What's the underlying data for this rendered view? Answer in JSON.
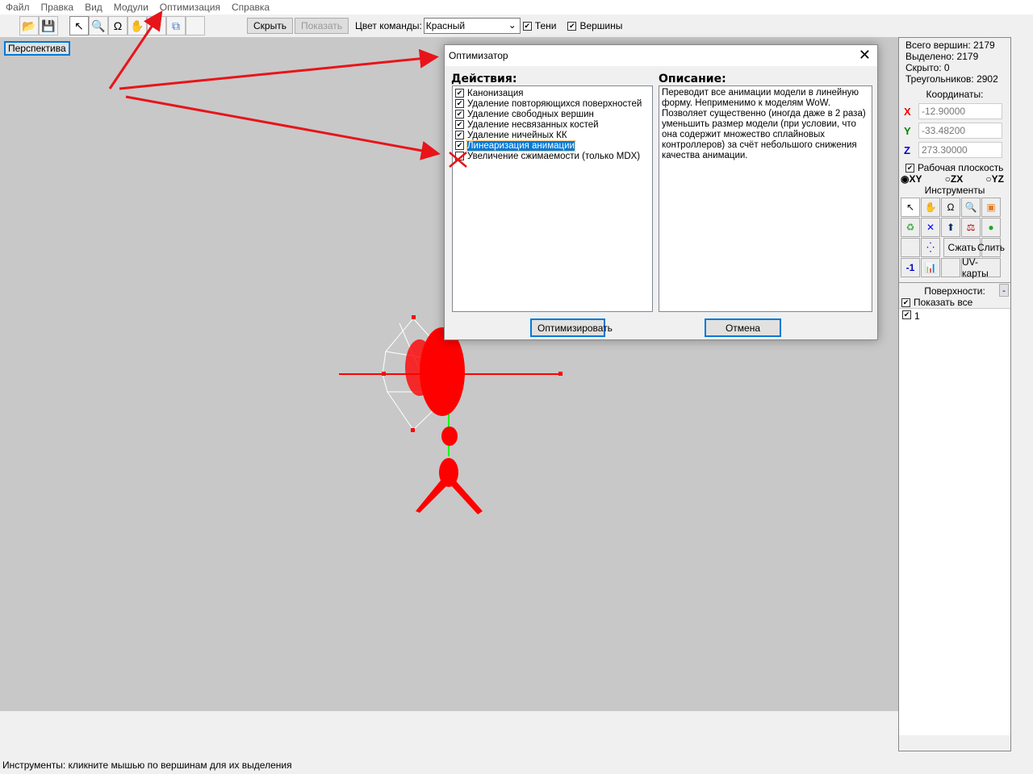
{
  "menu": [
    "Файл",
    "Правка",
    "Вид",
    "Модули",
    "Оптимизация",
    "Справка"
  ],
  "toolbar": {
    "hide": "Скрыть",
    "show": "Показать",
    "team_color_label": "Цвет команды:",
    "team_color": "Красный",
    "shadows": "Тени",
    "vertices": "Вершины"
  },
  "viewport": {
    "mode": "Перспектива"
  },
  "panel": {
    "total": "Всего вершин: 2179",
    "selected": "Выделено: 2179",
    "hidden": "Скрыто: 0",
    "triangles": "Треугольников: 2902",
    "coords_label": "Координаты:",
    "x": "-12.90000",
    "y": "-33.48200",
    "z": "273.30000",
    "work_plane": "Рабочая плоскость",
    "planes": [
      "XY",
      "ZX",
      "YZ"
    ],
    "tools_label": "Инструменты",
    "compress": "Сжать",
    "merge": "Слить",
    "minus_one": "-1",
    "uv": "UV-карты",
    "surfaces": "Поверхности:",
    "surfaces_btn": "-",
    "show_all": "Показать все",
    "surface_1": "1"
  },
  "dialog": {
    "title": "Оптимизатор",
    "actions_label": "Действия:",
    "description_label": "Описание:",
    "actions": [
      {
        "label": "Канонизация",
        "checked": true
      },
      {
        "label": "Удаление повторяющихся поверхностей",
        "checked": true
      },
      {
        "label": "Удаление свободных вершин",
        "checked": true
      },
      {
        "label": "Удаление несвязанных костей",
        "checked": true
      },
      {
        "label": "Удаление ничейных КК",
        "checked": true
      },
      {
        "label": "Линеаризация анимации",
        "checked": true
      },
      {
        "label": "Увеличение сжимаемости (только MDX)",
        "checked": false
      }
    ],
    "description": "Переводит все анимации модели в линейную форму. Неприменимо к моделям WoW. Позволяет существенно (иногда даже в 2 раза) уменьшить размер модели (при условии, что она содержит множество сплайновых контроллеров) за счёт небольшого снижения качества анимации.",
    "optimize": "Оптимизировать",
    "cancel": "Отмена"
  },
  "status": "Инструменты: кликните мышью по вершинам для их выделения"
}
